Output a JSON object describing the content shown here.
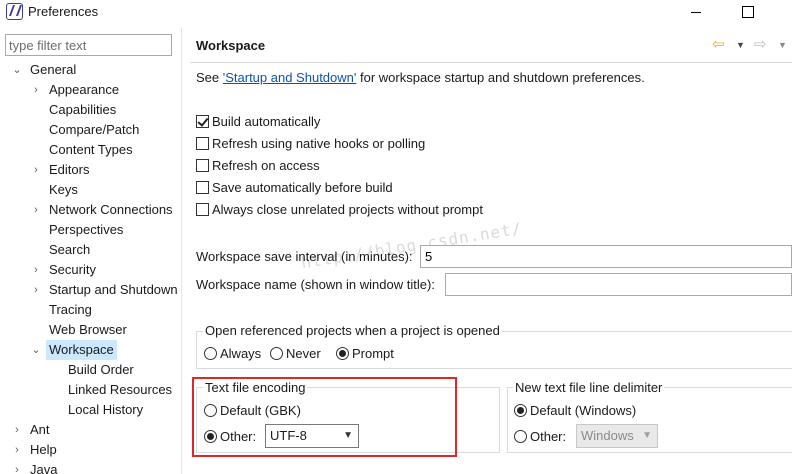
{
  "window": {
    "title": "Preferences"
  },
  "filter": {
    "placeholder": "type filter text"
  },
  "tree": {
    "general": "General",
    "items": [
      "Appearance",
      "Capabilities",
      "Compare/Patch",
      "Content Types",
      "Editors",
      "Keys",
      "Network Connections",
      "Perspectives",
      "Search",
      "Security",
      "Startup and Shutdown",
      "Tracing",
      "Web Browser",
      "Workspace"
    ],
    "workspace_children": [
      "Build Order",
      "Linked Resources",
      "Local History"
    ],
    "roots": [
      "Ant",
      "Help",
      "Java"
    ]
  },
  "page": {
    "title": "Workspace",
    "see_prefix": "See ",
    "see_link": "'Startup and Shutdown'",
    "see_suffix": " for workspace startup and shutdown preferences.",
    "checkboxes": [
      {
        "label": "Build automatically",
        "checked": true
      },
      {
        "label": "Refresh using native hooks or polling",
        "checked": false
      },
      {
        "label": "Refresh on access",
        "checked": false
      },
      {
        "label": "Save automatically before build",
        "checked": false
      },
      {
        "label": "Always close unrelated projects without prompt",
        "checked": false
      }
    ],
    "save_interval_label": "Workspace save interval (in minutes):",
    "save_interval_value": "5",
    "workspace_name_label": "Workspace name (shown in window title):",
    "workspace_name_value": "",
    "open_ref": {
      "title": "Open referenced projects when a project is opened",
      "options": [
        "Always",
        "Never",
        "Prompt"
      ],
      "selected": "Prompt"
    },
    "encoding": {
      "title": "Text file encoding",
      "default_label": "Default (GBK)",
      "other_label": "Other:",
      "selected": "Other",
      "other_value": "UTF-8"
    },
    "line_delimiter": {
      "title": "New text file line delimiter",
      "default_label": "Default (Windows)",
      "other_label": "Other:",
      "selected": "Default",
      "other_value": "Windows"
    }
  },
  "watermark": "http://blog.csdn.net/",
  "colors": {
    "selection": "#cce8ff",
    "link": "#0b52b0",
    "highlight_border": "#e0262b"
  }
}
